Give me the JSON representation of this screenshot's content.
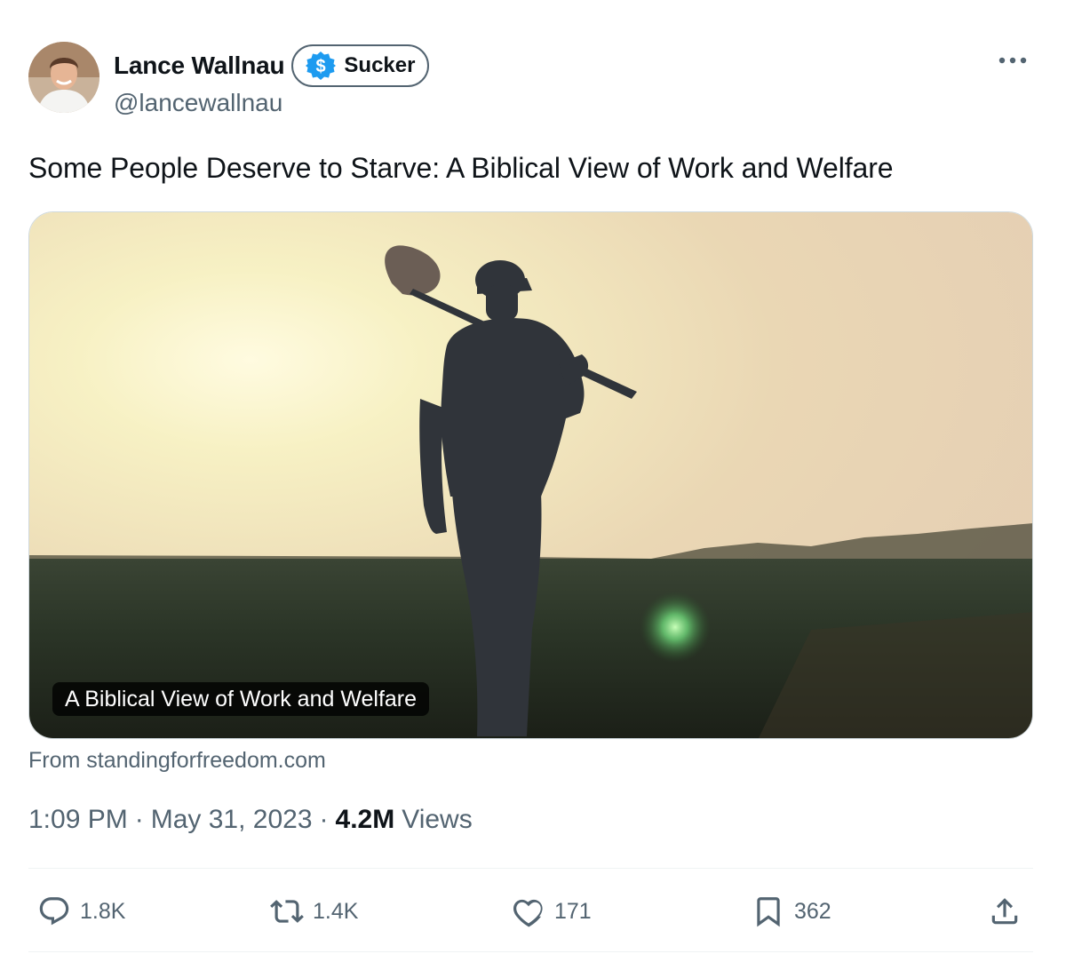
{
  "author": {
    "display_name": "Lance Wallnau",
    "handle": "@lancewallnau",
    "badge_label": "Sucker",
    "badge_icon": "dollar-badge-icon",
    "badge_color": "#1d9bf0"
  },
  "tweet": {
    "text": "Some People Deserve to Starve: A Biblical View of Work and Welfare"
  },
  "card": {
    "caption": "A Biblical View of Work and Welfare",
    "source": "From standingforfreedom.com"
  },
  "meta": {
    "time": "1:09 PM",
    "separator": "·",
    "date": "May 31, 2023",
    "views_count": "4.2M",
    "views_label": "Views"
  },
  "actions": {
    "reply": {
      "icon": "reply-icon",
      "count": "1.8K"
    },
    "repost": {
      "icon": "repost-icon",
      "count": "1.4K"
    },
    "like": {
      "icon": "heart-icon",
      "count": "171"
    },
    "bookmark": {
      "icon": "bookmark-icon",
      "count": "362"
    },
    "share": {
      "icon": "share-icon"
    }
  },
  "colors": {
    "text_primary": "#0f1419",
    "text_secondary": "#536471",
    "divider": "#eff3f4"
  }
}
